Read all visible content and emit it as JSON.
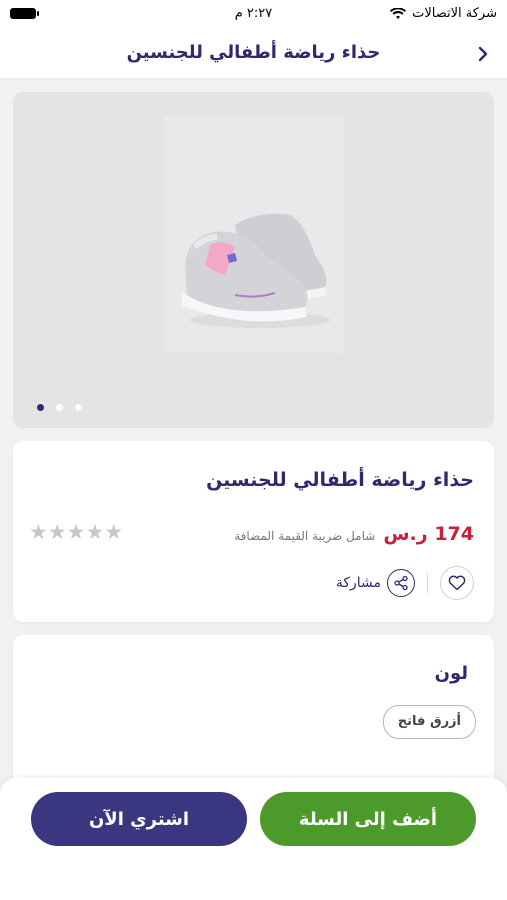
{
  "status_bar": {
    "carrier": "شركة الاتصالات",
    "time": "٢:٢٧ م"
  },
  "nav": {
    "title": "حذاء رياضة أطفالي للجنسين"
  },
  "gallery": {
    "dot_count": 3,
    "active_dot": 0
  },
  "product": {
    "title": "حذاء رياضة أطفالي للجنسين",
    "price": "174 ر.س",
    "vat_note": "شامل ضريبة القيمة المضافة",
    "rating": 0,
    "stars": "★★★★★",
    "share_label": "مشاركة"
  },
  "options": {
    "color_title": "لون",
    "color_value": "أزرق فاتح"
  },
  "buttons": {
    "add_to_cart": "أضف إلى السلة",
    "buy_now": "اشتري الآن"
  },
  "colors": {
    "brand_purple": "#2e2a6e",
    "price_red": "#cc1f3a",
    "cart_green": "#4c9a2a",
    "buy_purple": "#3b3680"
  }
}
